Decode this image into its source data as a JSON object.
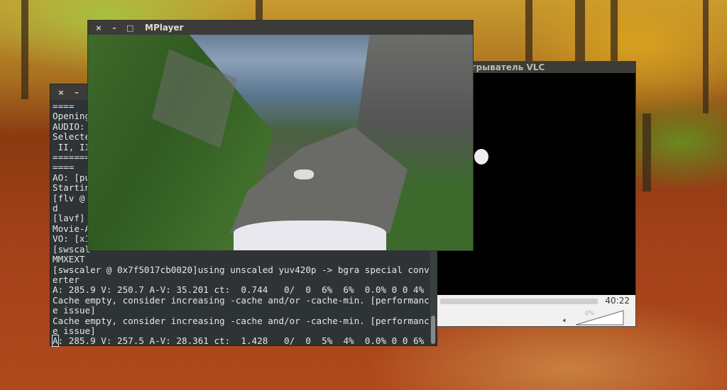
{
  "terminal": {
    "lines": [
      "====",
      "Opening",
      "AUDIO:",
      "Selecte",
      " II, II",
      "=======",
      "====",
      "AO: [pu",
      "Startin",
      "[flv @",
      "d",
      "[lavf]",
      "Movie-A",
      "VO: [x1",
      "[swscal",
      "MMXEXT",
      "[swscaler @ 0x7f5017cb0020]using unscaled yuv420p -> bgra special conv",
      "erter",
      "A: 285.9 V: 250.7 A-V: 35.201 ct:  0.744   0/  0  6%  6%  0.0% 0 0 4%",
      "Cache empty, consider increasing -cache and/or -cache-min. [performanc",
      "e issue]",
      "Cache empty, consider increasing -cache and/or -cache-min. [performanc",
      "e issue]"
    ],
    "cursor_char": "A",
    "last_line": ": 285.9 V: 257.5 A-V: 28.361 ct:  1.428   0/  0  5%  4%  0.0% 0 0 6%"
  },
  "mplayer": {
    "title": "MPlayer"
  },
  "vlc": {
    "title": "игрыватель VLC",
    "time": "40:22",
    "volume_label": "0%",
    "volume_percent": 0
  },
  "window_buttons": {
    "close": "×",
    "minimize": "–",
    "maximize": "□"
  }
}
